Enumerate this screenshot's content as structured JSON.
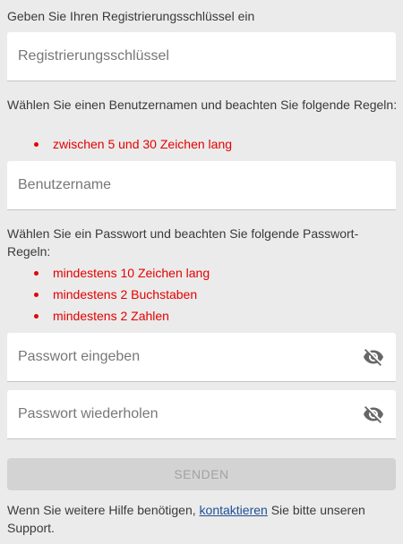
{
  "key_section": {
    "heading": "Geben Sie Ihren Registrierungsschlüssel ein",
    "input_placeholder": "Registrierungsschlüssel"
  },
  "username_section": {
    "instruction": "Wählen Sie einen Benutzernamen und beachten Sie folgende Regeln:",
    "rules": [
      "zwischen 5 und 30 Zeichen lang"
    ],
    "input_placeholder": "Benutzername"
  },
  "password_section": {
    "instruction": "Wählen Sie ein Passwort und beachten Sie folgende Passwort-Regeln:",
    "rules": [
      "mindestens 10 Zeichen lang",
      "mindestens 2 Buchstaben",
      "mindestens 2 Zahlen"
    ],
    "password_placeholder": "Passwort eingeben",
    "repeat_placeholder": "Passwort wiederholen",
    "visibility_icon": "eye-off-icon"
  },
  "submit": {
    "label": "SENDEN",
    "enabled": false
  },
  "help": {
    "before": "Wenn Sie weitere Hilfe benötigen, ",
    "link": "kontaktieren",
    "after": " Sie bitte unseren Support."
  },
  "colors": {
    "background": "#ebebeb",
    "rule_text": "#e50000",
    "link": "#1f4e94",
    "button_disabled_bg": "#d3d3d3",
    "button_disabled_text": "#a3a3a3"
  }
}
